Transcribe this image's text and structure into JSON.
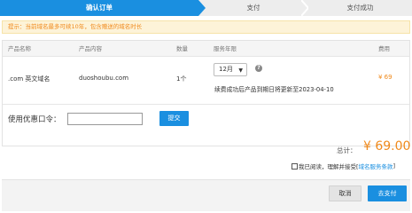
{
  "steps": [
    {
      "label": "确认订单"
    },
    {
      "label": "支付"
    },
    {
      "label": "支付成功"
    }
  ],
  "notice": "提示：当前域名最多可续10年，包含赠送的域名时长",
  "table": {
    "headers": [
      "产品名称",
      "产品内容",
      "数量",
      "服务年限",
      "费用"
    ],
    "row": {
      "product": ".com 英文域名",
      "content": "duoshoubu.com",
      "quantity": "1个",
      "term": "12月",
      "renewal_note": "续费成功后产品到期日将更新至2023-04-10",
      "price": "¥ 69"
    }
  },
  "promo": {
    "label": "使用优惠口令：",
    "input_value": "",
    "submit_label": "提交"
  },
  "total": {
    "label": "总计：",
    "value": "¥ 69.00"
  },
  "agreement": {
    "text": "我已阅读，理解并接受[",
    "link": "域名服务条款",
    "close": "]"
  },
  "footer": {
    "cancel_label": "取消",
    "pay_label": "去支付"
  },
  "colors": {
    "accent": "#1a8fe0",
    "price": "#f08a1c",
    "notice_bg": "#fdf3d8"
  }
}
